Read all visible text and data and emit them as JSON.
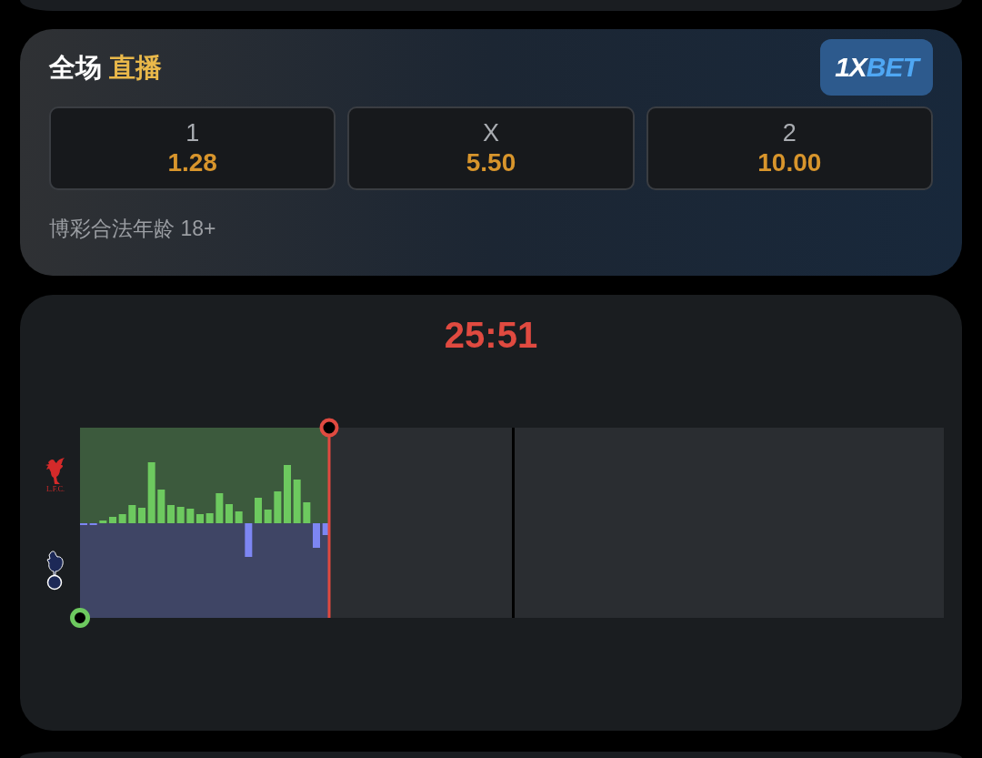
{
  "odds_card": {
    "title": {
      "text": "全场",
      "highlight": "直播"
    },
    "sponsor": {
      "lead": "1X",
      "rest": "BET"
    },
    "odds": [
      {
        "label": "1",
        "value": "1.28"
      },
      {
        "label": "X",
        "value": "5.50"
      },
      {
        "label": "2",
        "value": "10.00"
      }
    ],
    "disclaimer": "博彩合法年龄 18+"
  },
  "timeline_card": {
    "clock": "25:51",
    "crests": [
      {
        "kind": "bird",
        "text": "L.F.C."
      },
      {
        "kind": "cockerel"
      }
    ],
    "timeline": {
      "level": 0.288
    }
  }
}
